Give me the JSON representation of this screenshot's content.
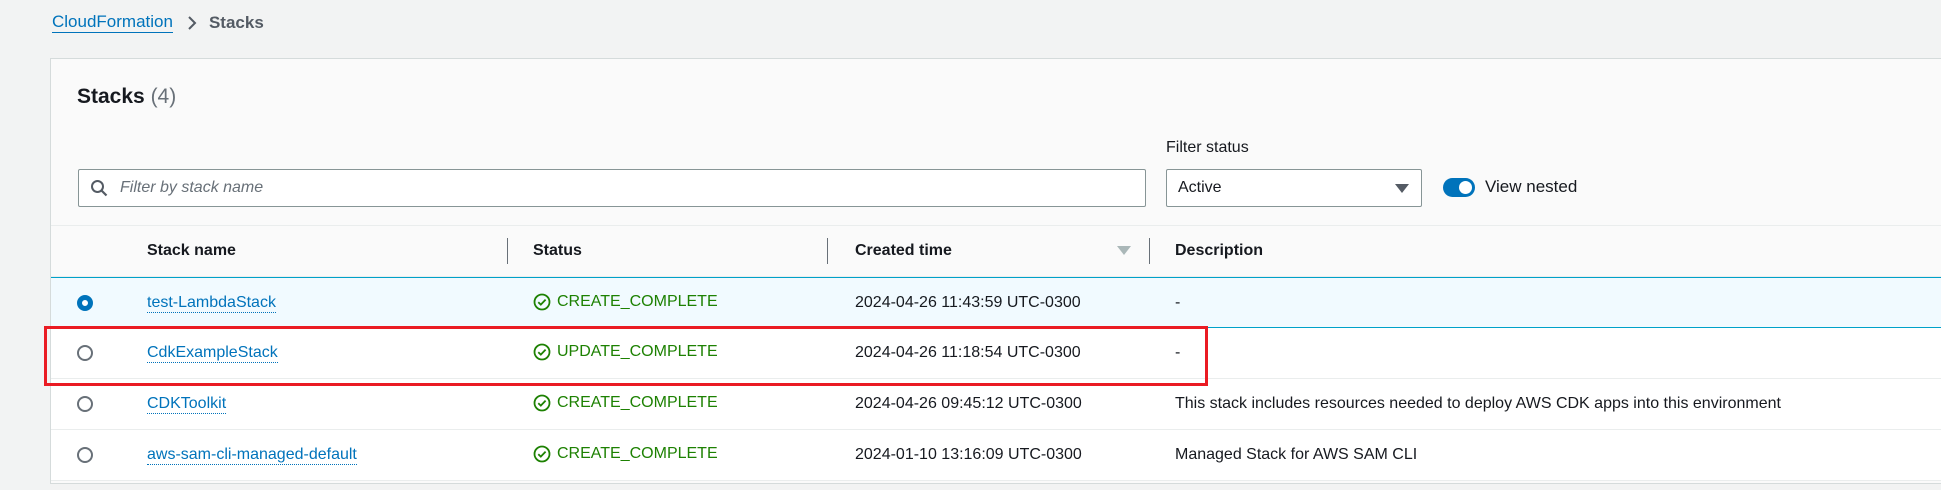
{
  "breadcrumb": {
    "root": "CloudFormation",
    "current": "Stacks"
  },
  "panel": {
    "title": "Stacks",
    "count": "(4)"
  },
  "search": {
    "placeholder": "Filter by stack name",
    "icon": "search-icon"
  },
  "filter": {
    "label": "Filter status",
    "selected": "Active"
  },
  "toggle": {
    "label": "View nested",
    "on": true
  },
  "table": {
    "columns": [
      "Stack name",
      "Status",
      "Created time",
      "Description"
    ],
    "rows": [
      {
        "name": "test-LambdaStack",
        "status": "CREATE_COMPLETE",
        "created": "2024-04-26 11:43:59 UTC-0300",
        "description": "-",
        "selected": true
      },
      {
        "name": "CdkExampleStack",
        "status": "UPDATE_COMPLETE",
        "created": "2024-04-26 11:18:54 UTC-0300",
        "description": "-",
        "selected": false
      },
      {
        "name": "CDKToolkit",
        "status": "CREATE_COMPLETE",
        "created": "2024-04-26 09:45:12 UTC-0300",
        "description": "This stack includes resources needed to deploy AWS CDK apps into this environment",
        "selected": false
      },
      {
        "name": "aws-sam-cli-managed-default",
        "status": "CREATE_COMPLETE",
        "created": "2024-01-10 13:16:09 UTC-0300",
        "description": "Managed Stack for AWS SAM CLI",
        "selected": false
      }
    ]
  },
  "colors": {
    "link": "#0073bb",
    "success": "#1d8102",
    "highlight": "#ea1b23"
  }
}
